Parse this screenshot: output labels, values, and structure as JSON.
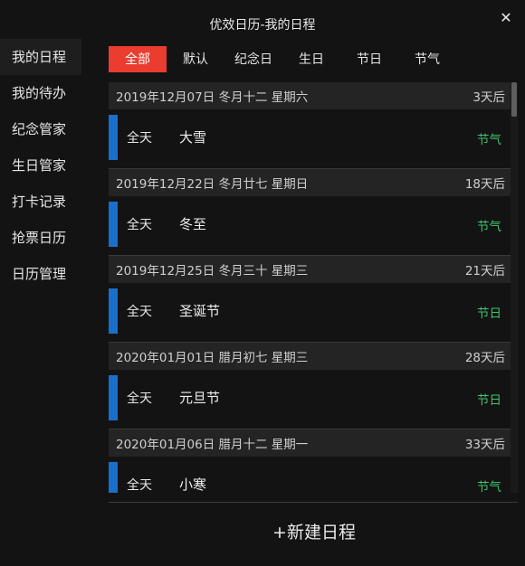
{
  "window": {
    "title": "优效日历-我的日程",
    "close_glyph": "✕"
  },
  "sidebar": {
    "items": [
      {
        "label": "我的日程",
        "active": true
      },
      {
        "label": "我的待办"
      },
      {
        "label": "纪念管家"
      },
      {
        "label": "生日管家"
      },
      {
        "label": "打卡记录"
      },
      {
        "label": "抢票日历"
      },
      {
        "label": "日历管理"
      }
    ]
  },
  "tabs": [
    {
      "label": "全部",
      "active": true
    },
    {
      "label": "默认"
    },
    {
      "label": "纪念日"
    },
    {
      "label": "生日"
    },
    {
      "label": "节日"
    },
    {
      "label": "节气"
    }
  ],
  "events": [
    {
      "date": "2019年12月07日 冬月十二 星期六",
      "countdown": "3天后",
      "allday": "全天",
      "name": "大雪",
      "type": "节气"
    },
    {
      "date": "2019年12月22日 冬月廿七 星期日",
      "countdown": "18天后",
      "allday": "全天",
      "name": "冬至",
      "type": "节气"
    },
    {
      "date": "2019年12月25日 冬月三十 星期三",
      "countdown": "21天后",
      "allday": "全天",
      "name": "圣诞节",
      "type": "节日"
    },
    {
      "date": "2020年01月01日 腊月初七 星期三",
      "countdown": "28天后",
      "allday": "全天",
      "name": "元旦节",
      "type": "节日"
    },
    {
      "date": "2020年01月06日 腊月十二 星期一",
      "countdown": "33天后",
      "allday": "全天",
      "name": "小寒",
      "type": "节气"
    }
  ],
  "footer": {
    "new_label": "+新建日程"
  },
  "colors": {
    "accent": "#ea3d2f",
    "event_bar": "#1a6fca",
    "type_text": "#3ec46d"
  }
}
